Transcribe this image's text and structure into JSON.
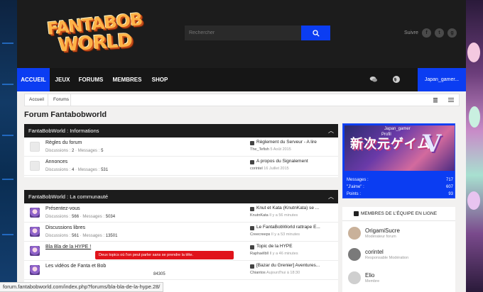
{
  "header": {
    "logo_line1": "FANTABOB",
    "logo_line2": "WORLD",
    "search_placeholder": "Rechercher",
    "follow_label": "Suivre",
    "social": [
      {
        "icon": "facebook-icon",
        "glyph": "f"
      },
      {
        "icon": "twitter-icon",
        "glyph": "t"
      },
      {
        "icon": "google-plus-icon",
        "glyph": "g"
      }
    ]
  },
  "nav": {
    "items": [
      {
        "label": "ACCUEIL",
        "active": true
      },
      {
        "label": "JEUX",
        "active": false
      },
      {
        "label": "FORUMS",
        "active": false
      },
      {
        "label": "MEMBRES",
        "active": false
      },
      {
        "label": "SHOP",
        "active": false
      }
    ],
    "user": "Japan_gamer..."
  },
  "breadcrumb": [
    "Accueil",
    "Forums"
  ],
  "page_title": "Forum Fantabobworld",
  "sections": [
    {
      "title": "FantaBobWorld : Informations",
      "forums": [
        {
          "title": "Règles du forum",
          "discussions_label": "Discussions :",
          "discussions": "2",
          "messages_label": "Messages :",
          "messages": "5",
          "last_title": "Règlement du Serveur - A lire",
          "last_user": "The_Tefish",
          "last_date": "5 Août 2015",
          "icon": "plain"
        },
        {
          "title": "Annonces",
          "discussions_label": "Discussions :",
          "discussions": "4",
          "messages_label": "Messages :",
          "messages": "531",
          "last_title": "A propos du Signalement",
          "last_user": "corintel",
          "last_date": "16 Juillet 2015",
          "icon": "plain"
        }
      ]
    },
    {
      "title": "FantaBobWorld : La communauté",
      "forums": [
        {
          "title": "Présentez-vous",
          "discussions_label": "Discussions :",
          "discussions": "566",
          "messages_label": "Messages :",
          "messages": "5034",
          "last_title": "Knut et Kata (KnutnKata) se ...",
          "last_user": "KnutnKata",
          "last_date": "Il y a 56 minutes",
          "icon": "neptune"
        },
        {
          "title": "Discussions libres",
          "discussions_label": "Discussions :",
          "discussions": "561",
          "messages_label": "Messages :",
          "messages": "13501",
          "last_title": "Le FantaBobWorld rattrape E...",
          "last_user": "Creecreeps",
          "last_date": "Il y a 53 minutes",
          "icon": "neptune"
        },
        {
          "title": "Bla Bla de la HYPE !",
          "discussions_label": "Discussions :",
          "discussions": "",
          "messages_label": "Messages :",
          "messages": "",
          "last_title": "Topic de la HYPE",
          "last_user": "Raphaëlbll",
          "last_date": "Il y a 46 minutes",
          "icon": "neptune"
        },
        {
          "title": "Les vidéos de Fanta et Bob",
          "discussions_label": "",
          "discussions": "",
          "messages_label": "",
          "messages": "84305",
          "last_title": "[Bazar du Grenier] Aventures...",
          "last_user": "Chiantos",
          "last_date": "Aujourd'hui à 18:30",
          "icon": "neptune"
        }
      ]
    }
  ],
  "tooltip": "Deux topics où l'on peut parler sans se prendre la tête.",
  "banner": {
    "art_text": "新次元ゲイム",
    "art_numeral": "V",
    "username": "Japan_gamer",
    "profile_link": "Profil",
    "stats": [
      {
        "label": "Messages :",
        "value": "717"
      },
      {
        "label": "\"J'aime\" :",
        "value": "607"
      },
      {
        "label": "Points :",
        "value": "93"
      }
    ]
  },
  "staff": {
    "title": "MEMBRES DE L'ÉQUIPE EN LIGNE",
    "members": [
      {
        "name": "OrigamiSucre",
        "role": "Modérateur forum",
        "color": "#c9b19a"
      },
      {
        "name": "corintel",
        "role": "Responsable Modération",
        "color": "#7a7a7a"
      },
      {
        "name": "Elio",
        "role": "Membre",
        "color": "#cfcfcf"
      }
    ]
  },
  "status_url": "forum.fantabobworld.com/index.php?forums/bla-bla-de-la-hype.28/"
}
